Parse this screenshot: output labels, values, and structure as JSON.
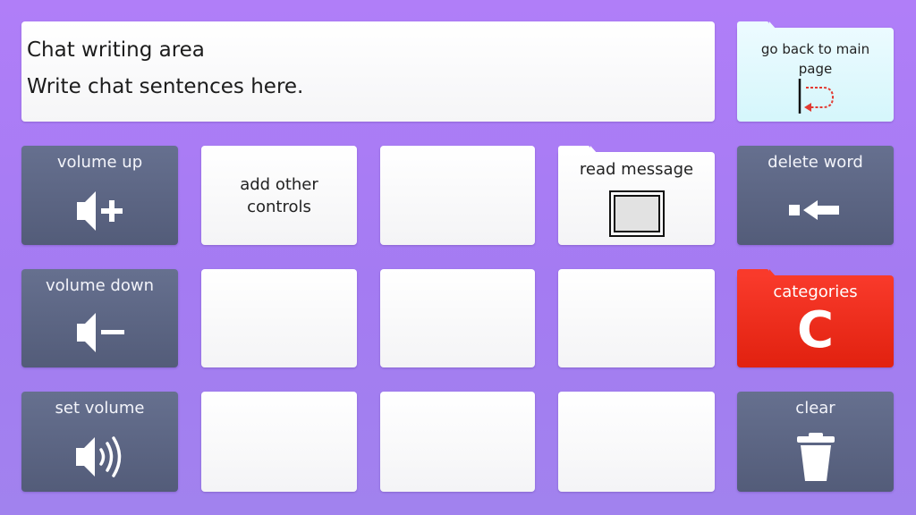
{
  "chat": {
    "title": "Chat writing area",
    "placeholder": "Write chat sentences here."
  },
  "buttons": {
    "back": "go back to main page",
    "volume_up": "volume up",
    "volume_down": "volume down",
    "set_volume": "set volume",
    "add_controls": "add other controls",
    "read_message": "read message",
    "delete_word": "delete word",
    "categories": "categories",
    "categories_letter": "C",
    "clear": "clear"
  },
  "icons": {
    "back": "return-arrow-icon",
    "volume_up": "volume-plus-icon",
    "volume_down": "volume-minus-icon",
    "set_volume": "speaker-waves-icon",
    "read_message": "message-box-icon",
    "delete_word": "backspace-arrow-icon",
    "clear": "trash-icon"
  },
  "colors": {
    "background": "#a77df4",
    "control_button": "#5d6684",
    "categories_button": "#ee2e1e",
    "back_button": "#dff8fc",
    "return_arrow": "#e23a32"
  }
}
